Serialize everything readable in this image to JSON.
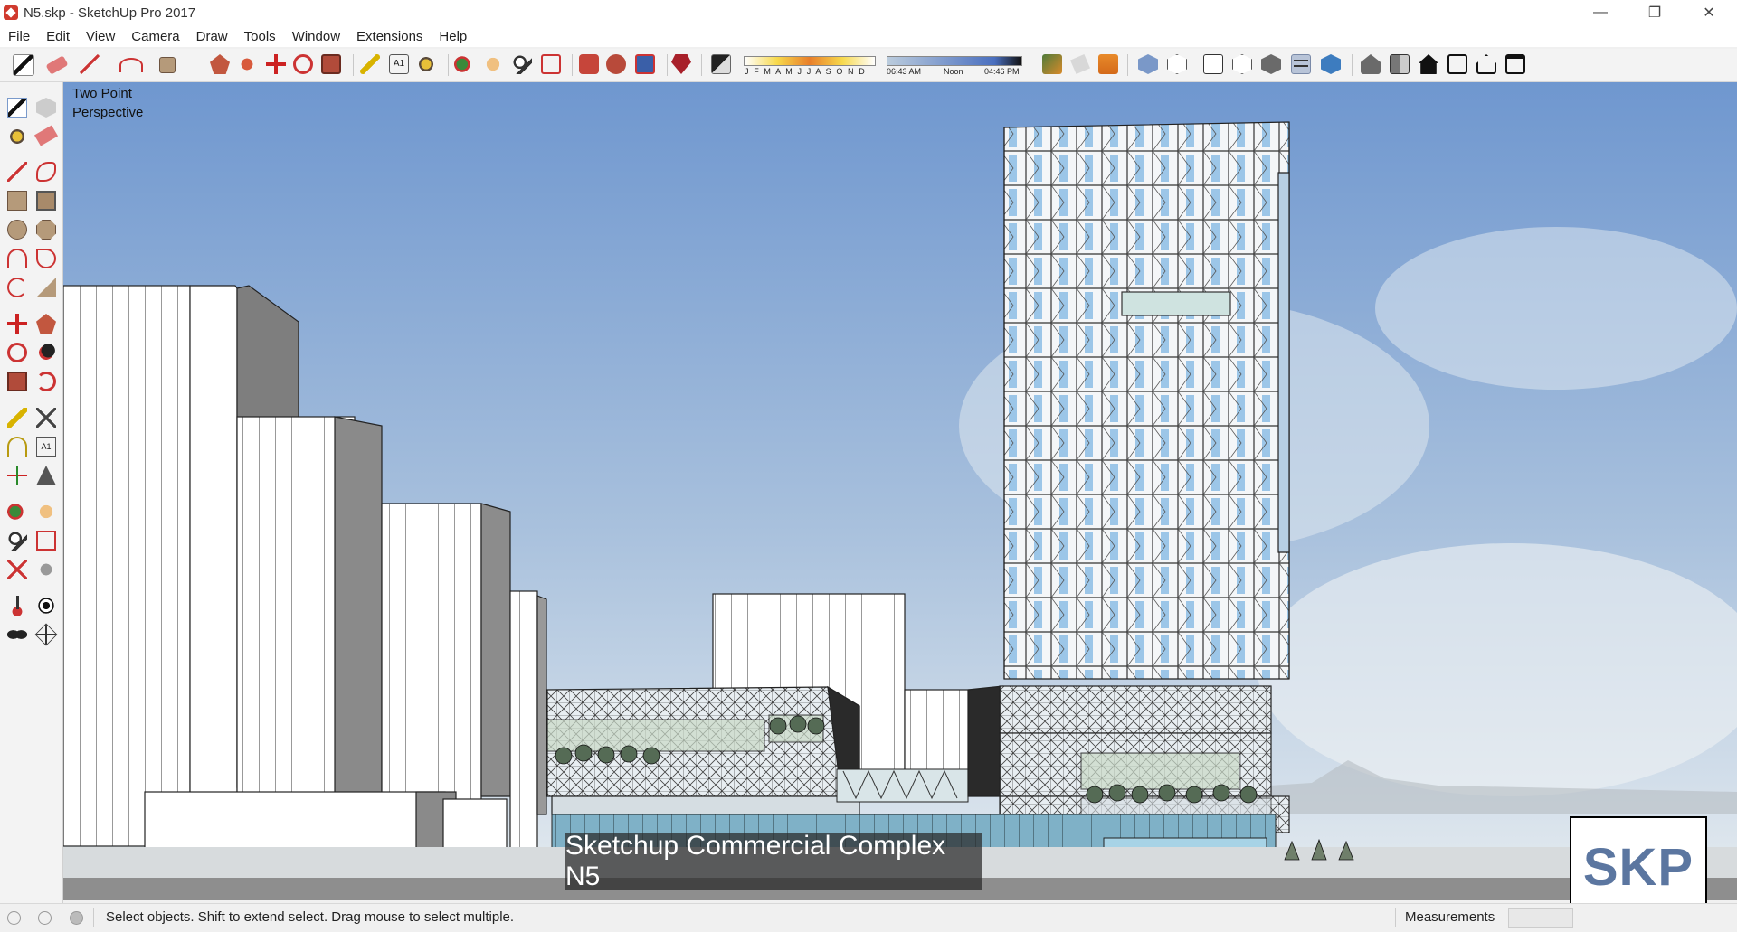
{
  "window": {
    "title": "N5.skp - SketchUp Pro 2017"
  },
  "menu": [
    "File",
    "Edit",
    "View",
    "Camera",
    "Draw",
    "Tools",
    "Window",
    "Extensions",
    "Help"
  ],
  "shadow_bar": {
    "months": "J F M A M J J A S O N D",
    "time_start": "06:43 AM",
    "time_mid": "Noon",
    "time_end": "04:46 PM"
  },
  "viewport": {
    "camera_label": "Two Point Perspective",
    "caption": "Sketchup Commercial Complex N5",
    "logo": "SKP"
  },
  "status": {
    "message": "Select objects. Shift to extend select. Drag mouse to select multiple.",
    "measurements_label": "Measurements",
    "measurements_value": ""
  },
  "colors": {
    "sky_top": "#6f97cf",
    "sky_bottom": "#dfe8ef",
    "glass": "#b5d3ec",
    "accent_red": "#c0392b"
  },
  "icons": {
    "toolbar": [
      "select-icon",
      "eraser-icon",
      "pencil-icon",
      "arc-icon",
      "rectangle-icon",
      "push-pull-icon",
      "follow-me-icon",
      "move-icon",
      "rotate-icon",
      "scale-icon",
      "tape-measure-icon",
      "text-icon",
      "paint-bucket-icon",
      "orbit-icon",
      "pan-icon",
      "zoom-icon",
      "zoom-extents-icon",
      "warehouse-icon",
      "extension-warehouse-icon",
      "layout-icon",
      "ruby-icon",
      "shadows-icon",
      "section-plane-icon",
      "section-display-icon",
      "section-cuts-icon",
      "xray-icon",
      "wireframe-icon",
      "hidden-line-icon",
      "shaded-icon",
      "shaded-textures-icon",
      "monochrome-icon",
      "iso-view-icon",
      "top-view-icon",
      "front-view-icon",
      "right-view-icon",
      "back-view-icon",
      "left-view-icon"
    ],
    "palette": [
      "select-icon",
      "component-icon",
      "paint-bucket-icon",
      "eraser-icon",
      "line-icon",
      "freehand-icon",
      "rectangle-icon",
      "rotated-rectangle-icon",
      "circle-icon",
      "polygon-icon",
      "arc-icon",
      "pie-icon",
      "two-point-arc-icon",
      "three-point-arc-icon",
      "move-icon",
      "push-pull-icon",
      "rotate-icon",
      "follow-me-icon",
      "scale-icon",
      "offset-icon",
      "tape-measure-icon",
      "dimension-icon",
      "protractor-icon",
      "text-icon",
      "axes-icon",
      "3d-text-icon",
      "orbit-icon",
      "pan-icon",
      "zoom-icon",
      "zoom-window-icon",
      "zoom-extents-icon",
      "previous-view-icon",
      "position-camera-icon",
      "look-around-icon",
      "walk-icon",
      "section-plane-icon"
    ]
  }
}
